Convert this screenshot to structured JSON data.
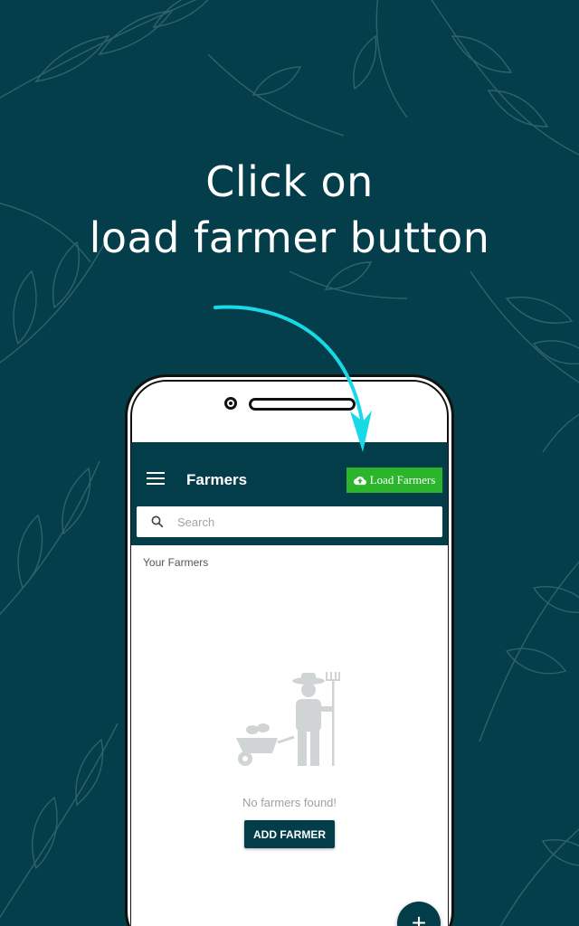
{
  "headline": {
    "line1": "Click on",
    "line2": "load farmer button"
  },
  "appbar": {
    "menu_icon": "hamburger-menu-icon",
    "title": "Farmers",
    "load_button_label": "Load Farmers",
    "load_button_icon": "cloud-upload-icon"
  },
  "search": {
    "placeholder": "Search",
    "value": "",
    "icon": "search-icon"
  },
  "section_label": "Your Farmers",
  "empty_state": {
    "illustration": "farmer-with-wheelbarrow-illustration",
    "message": "No farmers found!",
    "button_label": "ADD FARMER"
  },
  "fab": {
    "label": "+",
    "icon": "plus-icon"
  },
  "colors": {
    "background": "#033e4a",
    "appbar": "#043d4a",
    "load_button": "#2bb52b",
    "arrow": "#1ad9e6"
  }
}
